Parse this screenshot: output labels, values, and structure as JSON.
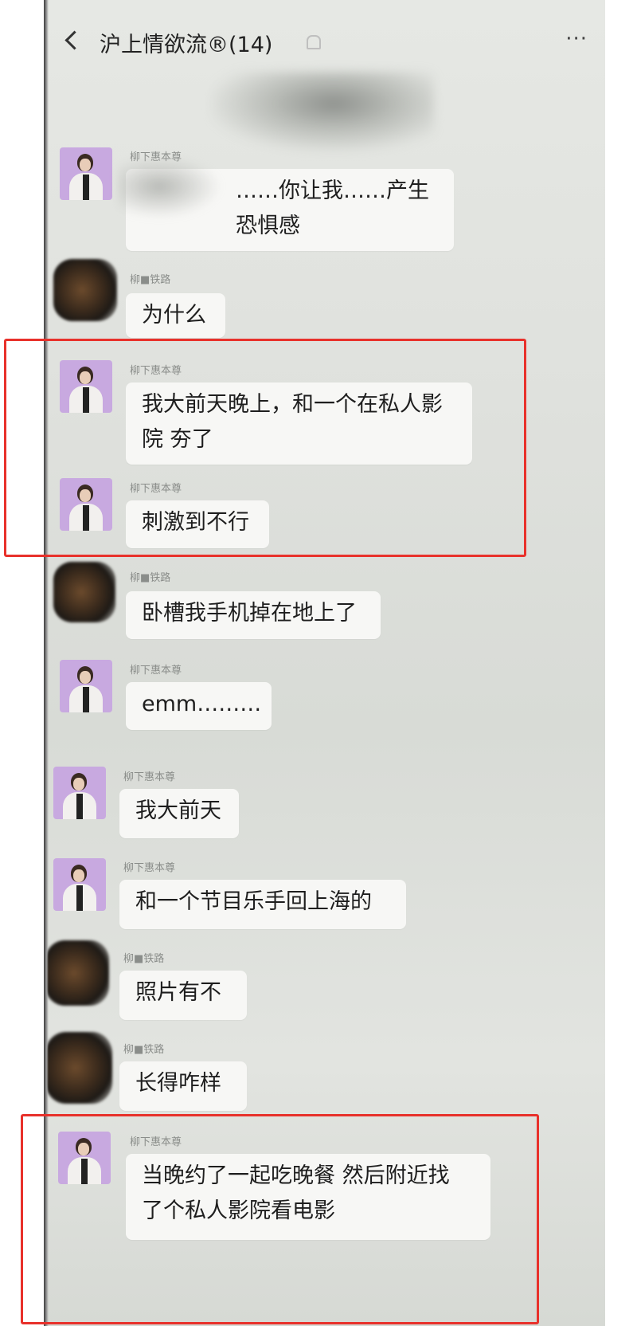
{
  "header": {
    "title": "沪上情欲流®(14)",
    "back_icon": "chevron-left-icon",
    "bell_icon": "bell-muted-icon",
    "more_label": "···"
  },
  "messages": [
    {
      "sender": "柳下惠本尊",
      "text_lines": [
        "……你让我……产生",
        "恐惧感"
      ],
      "avatar": "woman-avatar"
    },
    {
      "sender": "柳■铁路",
      "text_lines": [
        "为什么"
      ],
      "avatar": "blurred-avatar"
    },
    {
      "sender": "柳下惠本尊",
      "text_lines": [
        "我大前天晚上，和一个在私人影",
        "院 夯了"
      ],
      "avatar": "woman-avatar"
    },
    {
      "sender": "柳下惠本尊",
      "text_lines": [
        "刺激到不行"
      ],
      "avatar": "woman-avatar"
    },
    {
      "sender": "柳■铁路",
      "text_lines": [
        "卧槽我手机掉在地上了"
      ],
      "avatar": "blurred-avatar"
    },
    {
      "sender": "柳下惠本尊",
      "text_lines": [
        "emm………"
      ],
      "avatar": "woman-avatar"
    },
    {
      "sender": "柳下惠本尊",
      "text_lines": [
        "我大前天"
      ],
      "avatar": "woman-avatar"
    },
    {
      "sender": "柳下惠本尊",
      "text_lines": [
        "和一个节目乐手回上海的"
      ],
      "avatar": "woman-avatar"
    },
    {
      "sender": "柳■铁路",
      "text_lines": [
        "照片有不"
      ],
      "avatar": "blurred-avatar"
    },
    {
      "sender": "柳■铁路",
      "text_lines": [
        "长得咋样"
      ],
      "avatar": "blurred-avatar"
    },
    {
      "sender": "柳下惠本尊",
      "text_lines": [
        "当晚约了一起吃晚餐 然后附近找",
        "了个私人影院看电影"
      ],
      "avatar": "woman-avatar"
    }
  ],
  "colors": {
    "highlight": "#e8312b",
    "bubble": "#f7f7f5",
    "chat_bg": "#dfe1dd",
    "avatar_purple": "#c8a9e0"
  }
}
